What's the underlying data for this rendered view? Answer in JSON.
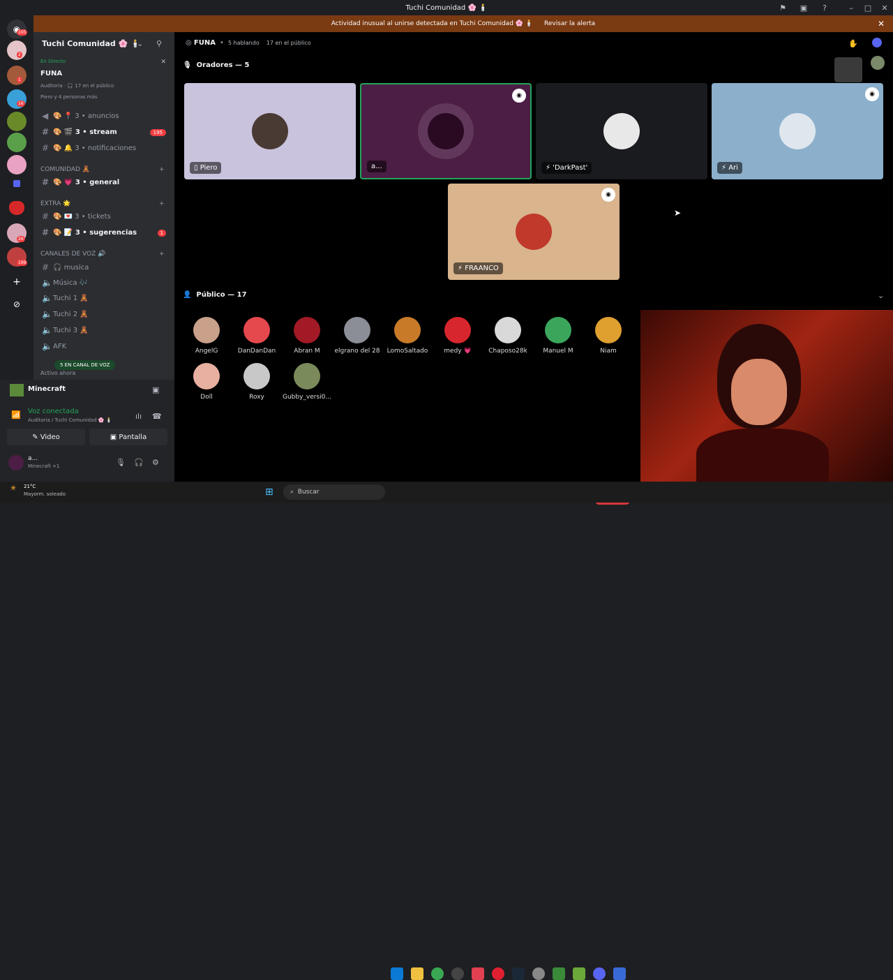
{
  "window": {
    "title": "Tuchi Comunidad 🌸 🕯️"
  },
  "banner": {
    "text": "Actividad inusual al unirse detectada en Tuchi Comunidad 🌸 🕯️",
    "button": "Revisar la alerta"
  },
  "servers": {
    "badges": [
      "105",
      "2",
      "1",
      "16",
      "26",
      "199"
    ]
  },
  "sidebar": {
    "server_name": "Tuchi Comunidad 🌸 🕯️",
    "live": {
      "status": "En Directo",
      "channel": "FUNA",
      "meta": "Auditoria · 🎧 17 en el público",
      "people": "Piero y 4 personas más"
    },
    "channels": [
      {
        "prefix": "🎨 📍 3",
        "name": "anuncios",
        "bold": false
      },
      {
        "prefix": "🎨 🎬 3",
        "name": "stream",
        "bold": true,
        "badge": "195"
      },
      {
        "prefix": "🎨 🔔 3",
        "name": "notificaciones",
        "bold": false
      }
    ],
    "cat_comunidad": "COMUNIDAD 🧸",
    "comunidad": [
      {
        "prefix": "🎨 💗 3",
        "name": "general",
        "bold": true
      }
    ],
    "cat_extra": "EXTRA 🌟",
    "extra": [
      {
        "prefix": "🎨 💌 3",
        "name": "tickets",
        "bold": false
      },
      {
        "prefix": "🎨 📝 3",
        "name": "sugerencias",
        "bold": true,
        "badge": "1"
      }
    ],
    "cat_voz": "CANALES DE VOZ 🔊",
    "voz": [
      {
        "name": "🎧 musica"
      },
      {
        "name": "Música 🎶"
      },
      {
        "name": "Tuchi 1 🧸"
      },
      {
        "name": "Tuchi 2 🧸"
      },
      {
        "name": "Tuchi 3 🧸"
      },
      {
        "name": "AFK"
      }
    ],
    "voice_pill": "5 EN CANAL DE VOZ",
    "active_now": "Activo ahora"
  },
  "user_panel": {
    "activity": "Minecraft",
    "voice_status": "Voz conectada",
    "voice_sub": "Auditoria / Tuchi Comunidad 🌸 🕯️",
    "video_btn": "Video",
    "screen_btn": "Pantalla",
    "username": "a...",
    "user_sub": "Minecraft +1"
  },
  "stage": {
    "channel": "FUNA",
    "speaking": "5 hablando",
    "audience_count": "17 en el público",
    "speakers_header": "Oradores — 5",
    "speakers": [
      {
        "name": "Piero",
        "bg": "#c9c3dd"
      },
      {
        "name": "a...",
        "bg": "#4c1d45"
      },
      {
        "name": "'DarkPast'",
        "bg": "#1a1b1e"
      },
      {
        "name": "Ari",
        "bg": "#8cb0cc"
      },
      {
        "name": "FRAANCO",
        "bg": "#d9b48c"
      }
    ],
    "audience_header": "Público — 17",
    "audience": [
      {
        "name": "AngelG",
        "color": "#c9a08a"
      },
      {
        "name": "DanDanDan",
        "color": "#e5484d"
      },
      {
        "name": "Abran M",
        "color": "#a11a25"
      },
      {
        "name": "elgrano del 28",
        "color": "#8b8e96"
      },
      {
        "name": "LomoSaltado",
        "color": "#c87a28"
      },
      {
        "name": "medy 💗",
        "color": "#d8262e"
      },
      {
        "name": "Chaposo28k",
        "color": "#d9d9d9"
      },
      {
        "name": "Manuel M",
        "color": "#3ba55c"
      },
      {
        "name": "Niam",
        "color": "#e0a030"
      },
      {
        "name": "Doll",
        "color": "#e8b0a0"
      },
      {
        "name": "Roxy",
        "color": "#c8c8c8"
      },
      {
        "name": "Gubby_versi0...",
        "color": "#7a8a5a"
      }
    ]
  },
  "taskbar": {
    "weather_temp": "21°C",
    "weather_desc": "Mayorm. soleado",
    "search": "Buscar"
  }
}
